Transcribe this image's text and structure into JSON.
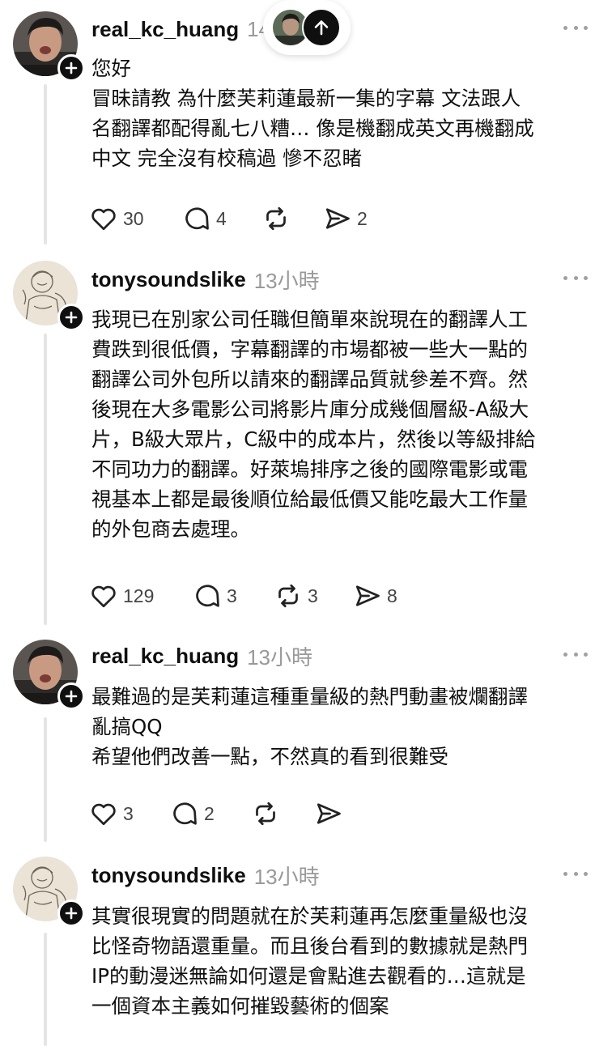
{
  "posts": [
    {
      "username": "real_kc_huang",
      "time": "14",
      "lines": [
        "您好",
        "冒昧請教 為什麼芙莉蓮最新一集的字幕 文法跟人",
        "名翻譯都配得亂七八糟… 像是機翻成英文再機翻成",
        "中文 完全沒有校稿過 慘不忍睹"
      ],
      "likes": "30",
      "comments": "4",
      "reposts": "",
      "shares": "2"
    },
    {
      "username": "tonysoundslike",
      "time": "13小時",
      "lines": [
        "我現已在別家公司任職但簡單來說現在的翻譯人工",
        "費跌到很低價，字幕翻譯的市場都被一些大一點的",
        "翻譯公司外包所以請來的翻譯品質就參差不齊。然",
        "後現在大多電影公司將影片庫分成幾個層級-A級大",
        "片，B級大眾片，C級中的成本片，然後以等級排給",
        "不同功力的翻譯。好萊塢排序之後的國際電影或電",
        "視基本上都是最後順位給最低價又能吃最大工作量",
        "的外包商去處理。"
      ],
      "likes": "129",
      "comments": "3",
      "reposts": "3",
      "shares": "8"
    },
    {
      "username": "real_kc_huang",
      "time": "13小時",
      "lines": [
        "最難過的是芙莉蓮這種重量級的熱門動畫被爛翻譯",
        "亂搞QQ",
        "希望他們改善一點，不然真的看到很難受"
      ],
      "likes": "3",
      "comments": "2",
      "reposts": "",
      "shares": ""
    },
    {
      "username": "tonysoundslike",
      "time": "13小時",
      "lines": [
        "其實很現實的問題就在於芙莉蓮再怎麼重量級也沒",
        "比怪奇物語還重量。而且後台看到的數據就是熱門",
        "IP的動漫迷無論如何還是會點進去觀看的…這就是",
        "一個資本主義如何摧毀藝術的個案"
      ]
    }
  ],
  "icons": {
    "like": "heart-icon",
    "comment": "comment-bubble-icon",
    "repost": "repost-icon",
    "share": "send-icon",
    "more": "more-dots-icon",
    "follow": "plus-icon",
    "scroll_top": "arrow-up-icon"
  },
  "colors": {
    "text": "#0f0f0f",
    "muted": "#999999",
    "count": "#444444",
    "thread_line": "#e5e5e5",
    "badge": "#0f0f0f"
  }
}
